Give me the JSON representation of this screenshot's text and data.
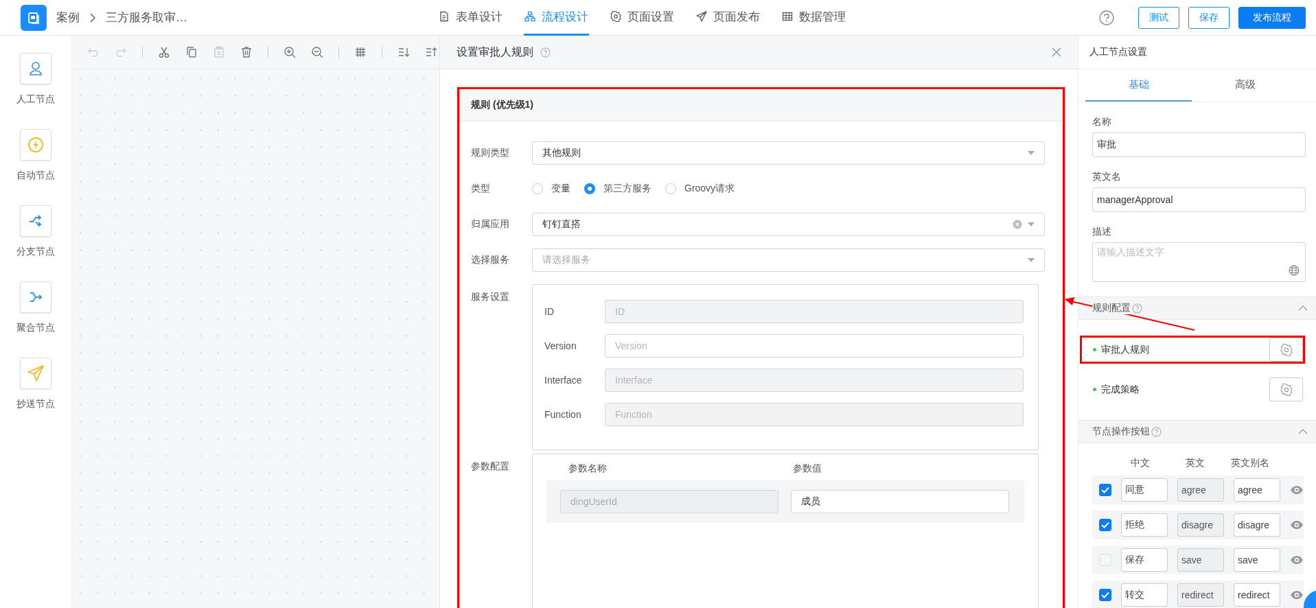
{
  "topbar": {
    "breadcrumb": [
      "案例",
      "三方服务取审…"
    ],
    "nav": [
      {
        "label": "表单设计",
        "kind": "doc",
        "selected": false
      },
      {
        "label": "流程设计",
        "kind": "flow",
        "selected": true
      },
      {
        "label": "页面设置",
        "kind": "gear",
        "selected": false
      },
      {
        "label": "页面发布",
        "kind": "send",
        "selected": false
      },
      {
        "label": "数据管理",
        "kind": "table",
        "selected": false
      }
    ],
    "buttons": [
      {
        "label": "测试",
        "kind": "outline"
      },
      {
        "label": "保存",
        "kind": "outline"
      },
      {
        "label": "发布流程",
        "kind": "primary"
      }
    ]
  },
  "palette": [
    {
      "label": "人工节点",
      "kind": "person"
    },
    {
      "label": "自动节点",
      "kind": "bolt"
    },
    {
      "label": "分支节点",
      "kind": "branch"
    },
    {
      "label": "聚合节点",
      "kind": "merge"
    },
    {
      "label": "抄送节点",
      "kind": "send"
    }
  ],
  "toolbar": [
    [
      {
        "kind": "undo",
        "disabled": true
      },
      {
        "kind": "redo",
        "disabled": true
      }
    ],
    [
      {
        "kind": "cut",
        "disabled": false
      },
      {
        "kind": "copy",
        "disabled": false
      },
      {
        "kind": "paste",
        "disabled": true
      },
      {
        "kind": "delete",
        "disabled": false
      }
    ],
    [
      {
        "kind": "zoom-in",
        "disabled": false
      },
      {
        "kind": "zoom-out",
        "disabled": false
      }
    ],
    [
      {
        "kind": "grid",
        "disabled": false
      }
    ],
    [
      {
        "kind": "sort-down",
        "disabled": false
      },
      {
        "kind": "sort-up",
        "disabled": false
      }
    ]
  ],
  "dialog": {
    "title": "设置审批人规则",
    "rule": {
      "title": "规则 (优先级1)",
      "annotated": true,
      "rule_type": {
        "label": "规则类型",
        "value": "其他规则"
      },
      "type": {
        "label": "类型",
        "options": [
          {
            "label": "变量",
            "selected": false
          },
          {
            "label": "第三方服务",
            "selected": true
          },
          {
            "label": "Groovy请求",
            "selected": false
          }
        ]
      },
      "app": {
        "label": "归属应用",
        "value": "钉钉直搭"
      },
      "service": {
        "label": "选择服务",
        "placeholder": "请选择服务"
      },
      "service_settings": {
        "label": "服务设置",
        "fields": [
          {
            "label": "ID",
            "placeholder": "ID",
            "disabled": true
          },
          {
            "label": "Version",
            "placeholder": "Version",
            "disabled": false
          },
          {
            "label": "Interface",
            "placeholder": "Interface",
            "disabled": true
          },
          {
            "label": "Function",
            "placeholder": "Function",
            "disabled": true
          }
        ]
      },
      "params": {
        "label": "参数配置",
        "columns": [
          "参数名称",
          "参数值"
        ],
        "rows": [
          {
            "name": "dingUserId",
            "value": "成员"
          }
        ]
      }
    }
  },
  "panel": {
    "title": "人工节点设置",
    "tabs": [
      {
        "label": "基础",
        "selected": true
      },
      {
        "label": "高级",
        "selected": false
      }
    ],
    "fields": [
      {
        "label": "名称",
        "kind": "input",
        "value": "审批"
      },
      {
        "label": "英文名",
        "kind": "input",
        "value": "managerApproval"
      },
      {
        "label": "描述",
        "kind": "textarea",
        "placeholder": "请输入描述文字"
      }
    ],
    "rule_config": {
      "title": "规则配置",
      "expanded": true,
      "items": [
        {
          "label": "审批人规则",
          "annotated": true
        },
        {
          "label": "完成策略",
          "annotated": false
        }
      ]
    },
    "node_buttons": {
      "title": "节点操作按钮",
      "expanded": true,
      "columns": [
        "中文",
        "英文",
        "英文别名"
      ],
      "rows": [
        {
          "checked": true,
          "zh": "同意",
          "en": "agree",
          "alias": "agree"
        },
        {
          "checked": true,
          "zh": "拒绝",
          "en": "disagre",
          "alias": "disagre"
        },
        {
          "checked": false,
          "zh": "保存",
          "en": "save",
          "alias": "save"
        },
        {
          "checked": true,
          "zh": "转交",
          "en": "redirect",
          "alias": "redirect"
        }
      ]
    }
  },
  "annotation_arrow": true
}
